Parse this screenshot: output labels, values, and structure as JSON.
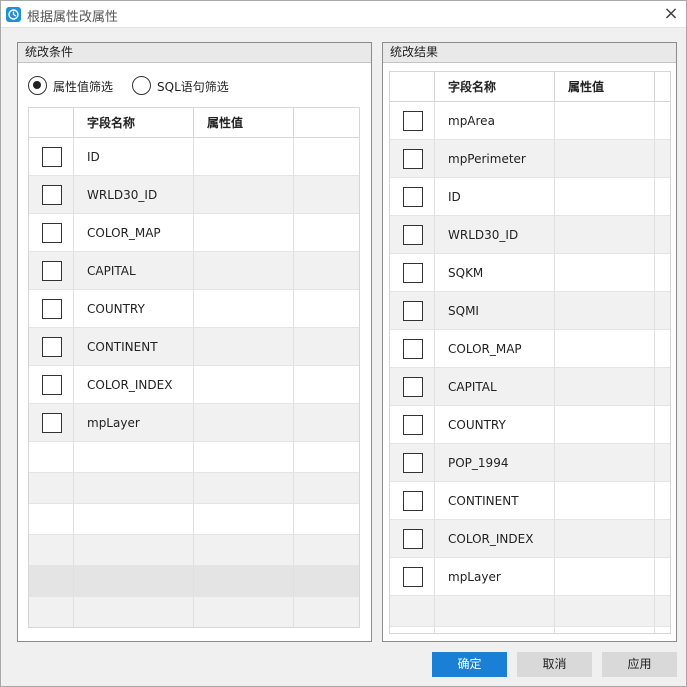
{
  "window": {
    "title": "根据属性改属性",
    "close_glyph": "×"
  },
  "left_panel": {
    "title": "统改条件",
    "radio_attr": {
      "label": "属性值筛选",
      "selected": true
    },
    "radio_sql": {
      "label": "SQL语句筛选",
      "selected": false
    },
    "columns": [
      "字段名称",
      "属性值"
    ],
    "rows": [
      {
        "field": "ID"
      },
      {
        "field": "WRLD30_ID"
      },
      {
        "field": "COLOR_MAP"
      },
      {
        "field": "CAPITAL"
      },
      {
        "field": "COUNTRY"
      },
      {
        "field": "CONTINENT"
      },
      {
        "field": "COLOR_INDEX"
      },
      {
        "field": "mpLayer"
      }
    ]
  },
  "right_panel": {
    "title": "统改结果",
    "columns": [
      "字段名称",
      "属性值"
    ],
    "rows": [
      {
        "field": "mpArea"
      },
      {
        "field": "mpPerimeter"
      },
      {
        "field": "ID"
      },
      {
        "field": "WRLD30_ID"
      },
      {
        "field": "SQKM"
      },
      {
        "field": "SQMI"
      },
      {
        "field": "COLOR_MAP"
      },
      {
        "field": "CAPITAL"
      },
      {
        "field": "COUNTRY"
      },
      {
        "field": "POP_1994"
      },
      {
        "field": "CONTINENT"
      },
      {
        "field": "COLOR_INDEX"
      },
      {
        "field": "mpLayer"
      }
    ]
  },
  "buttons": {
    "ok": "确定",
    "cancel": "取消",
    "apply": "应用"
  },
  "colors": {
    "primary_button": "#1a80d6",
    "row_alt": "#f1f1f1"
  }
}
